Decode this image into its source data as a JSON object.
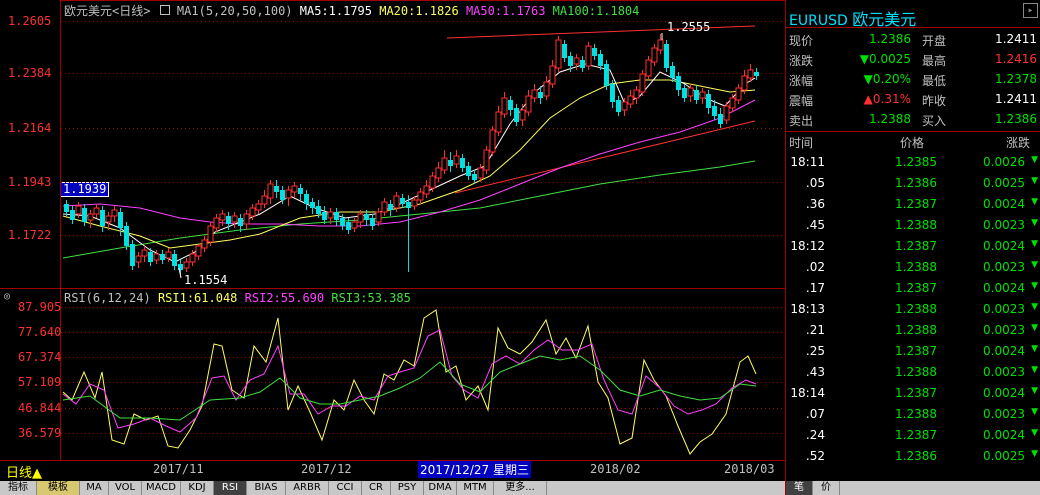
{
  "chart_header": {
    "title": "欧元美元<日线>",
    "ma_label": "MA1(5,20,50,100)",
    "ma5": "MA5:1.1795",
    "ma20": "MA20:1.1826",
    "ma50": "MA50:1.1763",
    "ma100": "MA100:1.1804"
  },
  "price_axis": [
    "1.2605",
    "1.2384",
    "1.2164",
    "1.1943",
    "1.1722"
  ],
  "price_marker": "1.1939",
  "annotations": {
    "high": "1.2555",
    "low": "1.1554"
  },
  "rsi_header": {
    "label": "RSI(6,12,24)",
    "rsi1": "RSI1:61.048",
    "rsi2": "RSI2:55.690",
    "rsi3": "RSI3:53.385"
  },
  "rsi_axis": [
    "87.905",
    "77.640",
    "67.374",
    "57.109",
    "46.844",
    "36.579"
  ],
  "x_axis": {
    "labels": [
      "2017/11",
      "2017/12",
      "2018/02",
      "2018/03"
    ],
    "cursor_label": "2017/12/27 星期三"
  },
  "period_button": "日线▲",
  "bottom_tabs": [
    "指标",
    "模板",
    "MA",
    "VOL",
    "MACD",
    "KDJ",
    "RSI",
    "BIAS",
    "ARBR",
    "CCI",
    "CR",
    "PSY",
    "DMA",
    "MTM",
    "更多..."
  ],
  "active_tab": "RSI",
  "right_panel": {
    "symbol": "EURUSD",
    "name": "欧元美元",
    "quote": [
      {
        "l1": "现价",
        "v1": "1.2386",
        "l2": "开盘",
        "v2": "1.2411"
      },
      {
        "l1": "涨跌",
        "v1": "▼0.0025",
        "l2": "最高",
        "v2": "1.2416"
      },
      {
        "l1": "涨幅",
        "v1": "▼0.20%",
        "l2": "最低",
        "v2": "1.2378"
      },
      {
        "l1": "震幅",
        "v1": "▲0.31%",
        "l2": "昨收",
        "v2": "1.2411"
      },
      {
        "l1": "卖出",
        "v1": "1.2388",
        "l2": "买入",
        "v2": "1.2386"
      }
    ],
    "tick_headers": [
      "时间",
      "价格",
      "涨跌"
    ],
    "ticks": [
      {
        "t": "18:11",
        "p": "1.2385",
        "c": "0.0026"
      },
      {
        "t": ".05",
        "p": "1.2386",
        "c": "0.0025"
      },
      {
        "t": ".36",
        "p": "1.2387",
        "c": "0.0024"
      },
      {
        "t": ".45",
        "p": "1.2388",
        "c": "0.0023"
      },
      {
        "t": "18:12",
        "p": "1.2387",
        "c": "0.0024"
      },
      {
        "t": ".02",
        "p": "1.2388",
        "c": "0.0023"
      },
      {
        "t": ".17",
        "p": "1.2387",
        "c": "0.0024"
      },
      {
        "t": "18:13",
        "p": "1.2388",
        "c": "0.0023"
      },
      {
        "t": ".21",
        "p": "1.2388",
        "c": "0.0023"
      },
      {
        "t": ".25",
        "p": "1.2387",
        "c": "0.0024"
      },
      {
        "t": ".43",
        "p": "1.2388",
        "c": "0.0023"
      },
      {
        "t": "18:14",
        "p": "1.2387",
        "c": "0.0024"
      },
      {
        "t": ".07",
        "p": "1.2388",
        "c": "0.0023"
      },
      {
        "t": ".24",
        "p": "1.2387",
        "c": "0.0024"
      },
      {
        "t": ".52",
        "p": "1.2386",
        "c": "0.0025"
      }
    ],
    "bottom_tabs": [
      "笔",
      "价"
    ]
  },
  "colors": {
    "up": "#ff3030",
    "down": "#00e0e0",
    "ma5": "#ffffff",
    "ma20": "#ffff60",
    "ma50": "#ff40ff",
    "ma100": "#40e040",
    "axis_red": "#a00000",
    "quote_green": "#00e000",
    "quote_red": "#ff3030",
    "label": "#c0c0c0"
  }
}
